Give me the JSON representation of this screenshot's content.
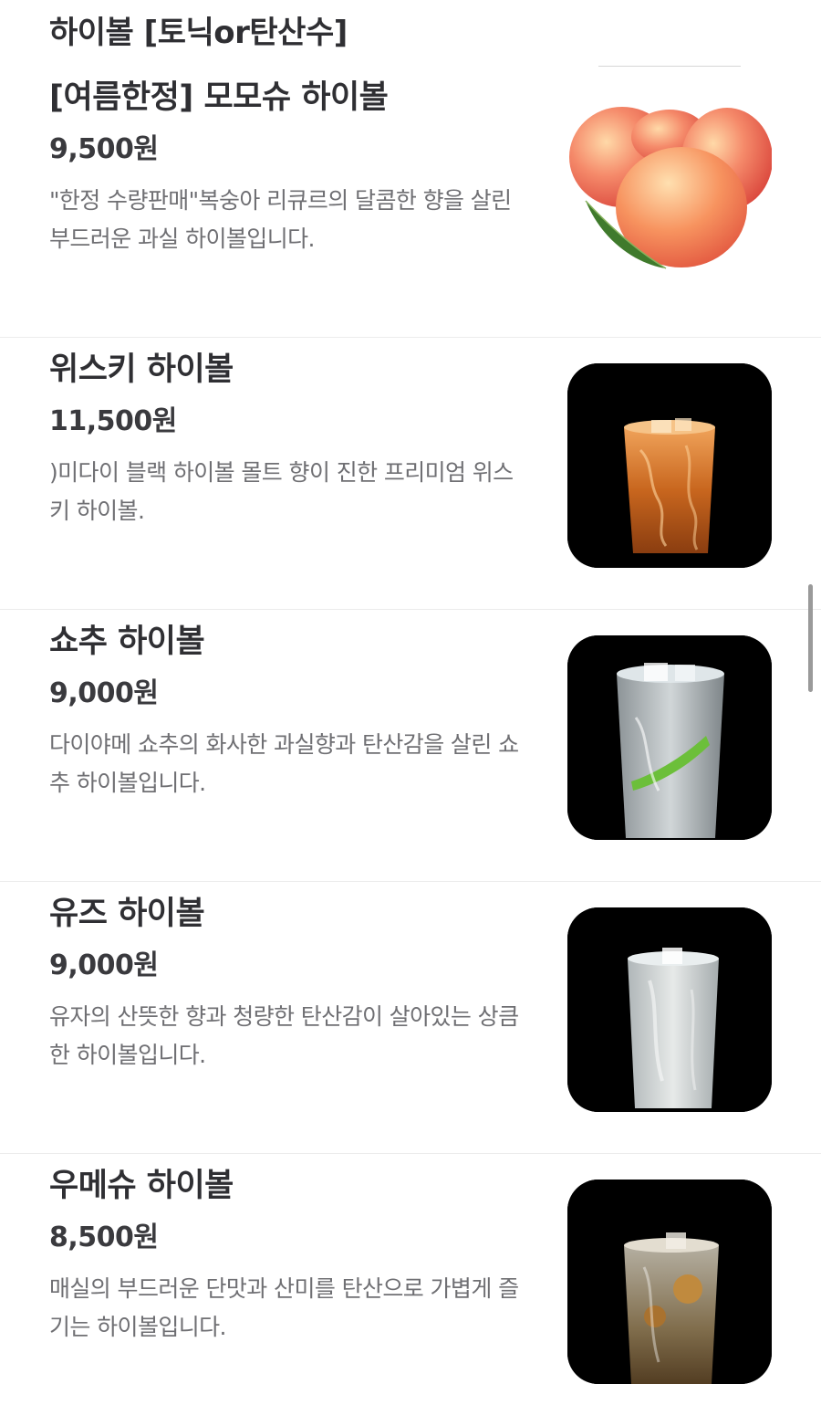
{
  "section": {
    "title": "하이볼 [토닉or탄산수]"
  },
  "items": [
    {
      "name": "[여름한정] 모모슈 하이볼",
      "price": "9,500원",
      "description": "\"한정 수량판매\"복숭아 리큐르의 달콤한 향을 살린 부드러운 과실 하이볼입니다.",
      "image": "peach-photo"
    },
    {
      "name": "위스키 하이볼",
      "price": "11,500원",
      "description": ")미다이 블랙 하이볼 몰트 향이 진한 프리미엄 위스키 하이볼.",
      "image": "whisky-highball-photo"
    },
    {
      "name": "쇼추 하이볼",
      "price": "9,000원",
      "description": "다이야메 쇼추의 화사한 과실향과 탄산감을 살린 쇼추 하이볼입니다.",
      "image": "shochu-highball-photo"
    },
    {
      "name": "유즈 하이볼",
      "price": "9,000원",
      "description": "유자의 산뜻한 향과 청량한 탄산감이 살아있는 상큼한 하이볼입니다.",
      "image": "yuzu-highball-photo"
    },
    {
      "name": "우메슈 하이볼",
      "price": "8,500원",
      "description": "매실의 부드러운 단맛과 산미를 탄산으로 가볍게 즐기는 하이볼입니다.",
      "image": "umeshu-highball-photo"
    }
  ],
  "colors": {
    "text_primary": "#2f2f33",
    "text_secondary": "#6f6f73",
    "divider": "#ececec",
    "thumb_background": "#000000"
  }
}
